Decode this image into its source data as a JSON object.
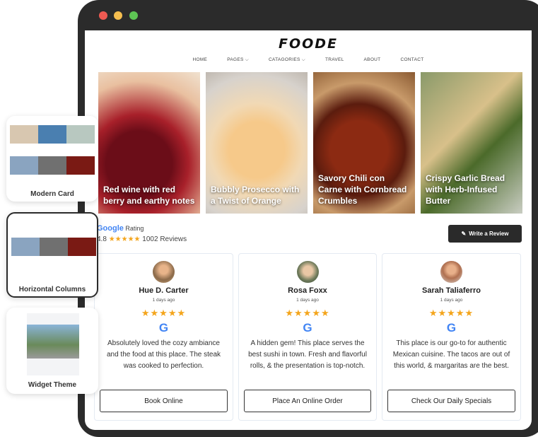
{
  "window": {
    "dots": [
      "#ee5a52",
      "#f5be4f",
      "#5ec454"
    ]
  },
  "site": {
    "logo": "FOODE",
    "nav": [
      "HOME",
      "PAGES ⌵",
      "CATAGORIES ⌵",
      "TRAVEL",
      "ABOUT",
      "CONTACT"
    ]
  },
  "tiles": [
    {
      "caption": "Red wine with red berry and earthy notes"
    },
    {
      "caption": "Bubbly Prosecco with a Twist of Orange"
    },
    {
      "caption": "Savory Chili con Carne with Cornbread Crumbles"
    },
    {
      "caption": "Crispy Garlic Bread with Herb-Infused Butter"
    }
  ],
  "rating": {
    "brand": "Google",
    "label": "Rating",
    "score": "4.8",
    "stars": "★★★★★",
    "count": "1002 Reviews",
    "write_label": "Write a Review"
  },
  "reviews": [
    {
      "name": "Hue D. Carter",
      "ago": "1 days ago",
      "stars": "★★★★★",
      "text": "Absolutely loved the cozy ambiance and the food at this place. The steak was cooked to perfection.",
      "button": "Book Online"
    },
    {
      "name": "Rosa Foxx",
      "ago": "1 days ago",
      "stars": "★★★★★",
      "text": "A hidden gem! This place serves the best sushi in town. Fresh and flavorful rolls, & the presentation is top-notch.",
      "button": "Place An Online Order"
    },
    {
      "name": "Sarah Taliaferro",
      "ago": "1 days ago",
      "stars": "★★★★★",
      "text": "This place is our go-to for authentic Mexican cuisine. The tacos are out of this world, & margaritas are the best.",
      "button": "Check Our Daily Specials"
    }
  ],
  "layouts": [
    {
      "label": "Modern Card"
    },
    {
      "label": "Horizontal Columns"
    },
    {
      "label": "Widget Theme"
    }
  ]
}
